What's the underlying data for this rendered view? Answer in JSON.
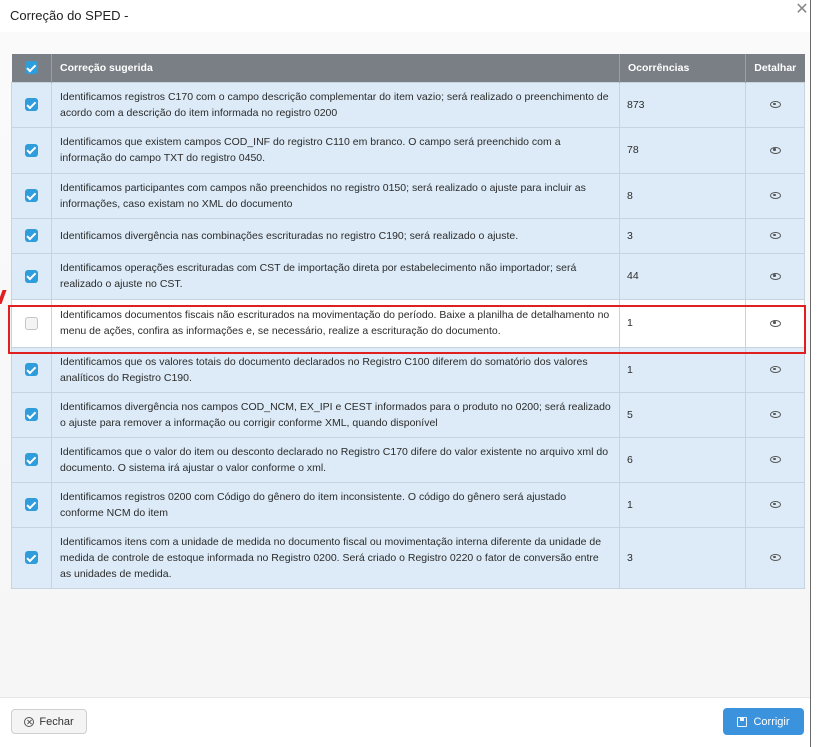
{
  "dialog": {
    "title": "Correção do SPED -",
    "close_glyph": "✕"
  },
  "table": {
    "headers": {
      "select_all_checked": true,
      "suggestion": "Correção sugerida",
      "occurrences": "Ocorrências",
      "details": "Detalhar"
    },
    "rows": [
      {
        "checked": true,
        "text": "Identificamos registros C170 com o campo descrição complementar do item vazio; será realizado o preenchimento de acordo com a descrição do item informada no registro 0200",
        "occurrences": "873"
      },
      {
        "checked": true,
        "text": "Identificamos que existem campos COD_INF do registro C110 em branco. O campo será preenchido com a informação do campo TXT do registro 0450.",
        "occurrences": "78"
      },
      {
        "checked": true,
        "text": "Identificamos participantes com campos não preenchidos no registro 0150; será realizado o ajuste para incluir as informações, caso existam no XML do documento",
        "occurrences": "8"
      },
      {
        "checked": true,
        "text": "Identificamos divergência nas combinações escrituradas no registro C190; será realizado o ajuste.",
        "occurrences": "3"
      },
      {
        "checked": true,
        "text": "Identificamos operações escrituradas com CST de importação direta por estabelecimento não importador; será realizado o ajuste no CST.",
        "occurrences": "44"
      },
      {
        "checked": false,
        "text": "Identificamos documentos fiscais não escriturados na movimentação do período. Baixe a planilha de detalhamento no menu de ações, confira as informações e, se necessário, realize a escrituração do documento.",
        "occurrences": "1"
      },
      {
        "checked": true,
        "text": "Identificamos que os valores totais do documento declarados no Registro C100 diferem do somatório dos valores analíticos do Registro C190.",
        "occurrences": "1"
      },
      {
        "checked": true,
        "text": "Identificamos divergência nos campos COD_NCM, EX_IPI e CEST informados para o produto no 0200; será realizado o ajuste para remover a informação ou corrigir conforme XML, quando disponível",
        "occurrences": "5"
      },
      {
        "checked": true,
        "text": "Identificamos que o valor do item ou desconto declarado no Registro C170 difere do valor existente no arquivo xml do documento. O sistema irá ajustar o valor conforme o xml.",
        "occurrences": "6"
      },
      {
        "checked": true,
        "text": "Identificamos registros 0200 com Código do gênero do item inconsistente. O código do gênero será ajustado conforme NCM do item",
        "occurrences": "1"
      },
      {
        "checked": true,
        "text": "Identificamos itens com a unidade de medida no documento fiscal ou movimentação interna diferente da unidade de medida de controle de estoque informada no Registro 0200. Será criado o Registro 0220 o fator de conversão entre as unidades de medida.",
        "occurrences": "3"
      }
    ],
    "details_icon": "eye-icon"
  },
  "footer": {
    "close_label": "Fechar",
    "close_icon": "x-circle-icon",
    "apply_label": "Corrigir",
    "apply_icon": "save-icon"
  },
  "colors": {
    "header_bg": "#7a7f85",
    "row_bg": "#dcebf7",
    "checkbox_blue": "#2f9cdc",
    "highlight_red": "#e02020",
    "primary_button": "#3b93de"
  }
}
